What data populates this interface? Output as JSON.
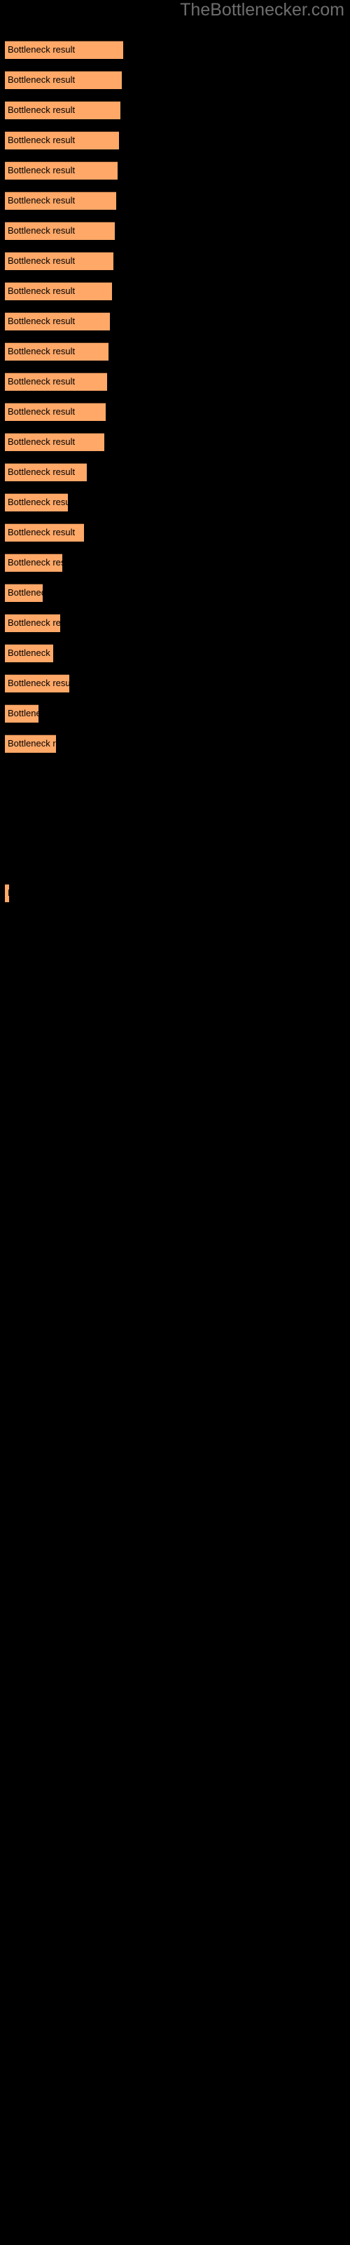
{
  "watermark": "TheBottlenecker.com",
  "colors": {
    "background": "#000000",
    "bar_fill": "#ffa868",
    "bar_edge": "#4a2e1c",
    "label_text": "#000000",
    "watermark_text": "#6e6e6e"
  },
  "bar_label": "Bottleneck result",
  "chart_data": {
    "type": "bar",
    "orientation": "horizontal",
    "title": "",
    "subtitle": "",
    "xlabel": "",
    "ylabel": "",
    "grid": false,
    "legend": false,
    "annotations": [
      "TheBottlenecker.com"
    ],
    "categories": [
      "Bottleneck result",
      "Bottleneck result",
      "Bottleneck result",
      "Bottleneck result",
      "Bottleneck result",
      "Bottleneck result",
      "Bottleneck result",
      "Bottleneck result",
      "Bottleneck result",
      "Bottleneck result",
      "Bottleneck result",
      "Bottleneck result",
      "Bottleneck result",
      "Bottleneck result",
      "Bottleneck result",
      "Bottleneck result",
      "Bottleneck result",
      "Bottleneck result",
      "Bottleneck result",
      "Bottleneck result",
      "Bottleneck result",
      "Bottleneck result",
      "Bottleneck result",
      "Bottleneck result",
      "Bottleneck result"
    ],
    "values": [
      81,
      80,
      79,
      78,
      77,
      76,
      75,
      74,
      73,
      72,
      71,
      70,
      69,
      68,
      56,
      43,
      54,
      39,
      26,
      38,
      33,
      44,
      23,
      35,
      3
    ],
    "xlim": [
      0,
      100
    ],
    "ylim": [
      0,
      25
    ]
  },
  "bars": [
    {
      "top": 58,
      "width": 81
    },
    {
      "top": 101,
      "width": 80
    },
    {
      "top": 144,
      "width": 79
    },
    {
      "top": 187,
      "width": 78
    },
    {
      "top": 230,
      "width": 77
    },
    {
      "top": 273,
      "width": 76
    },
    {
      "top": 316,
      "width": 75
    },
    {
      "top": 359,
      "width": 74
    },
    {
      "top": 402,
      "width": 73
    },
    {
      "top": 445,
      "width": 72
    },
    {
      "top": 488,
      "width": 71
    },
    {
      "top": 531,
      "width": 70
    },
    {
      "top": 574,
      "width": 69
    },
    {
      "top": 617,
      "width": 68
    },
    {
      "top": 660,
      "width": 56
    },
    {
      "top": 703,
      "width": 43
    },
    {
      "top": 746,
      "width": 54
    },
    {
      "top": 789,
      "width": 39
    },
    {
      "top": 832,
      "width": 26
    },
    {
      "top": 875,
      "width": 38
    },
    {
      "top": 918,
      "width": 33
    },
    {
      "top": 961,
      "width": 44
    },
    {
      "top": 1004,
      "width": 23
    },
    {
      "top": 1047,
      "width": 35
    },
    {
      "top": 1260,
      "width": 3
    }
  ]
}
